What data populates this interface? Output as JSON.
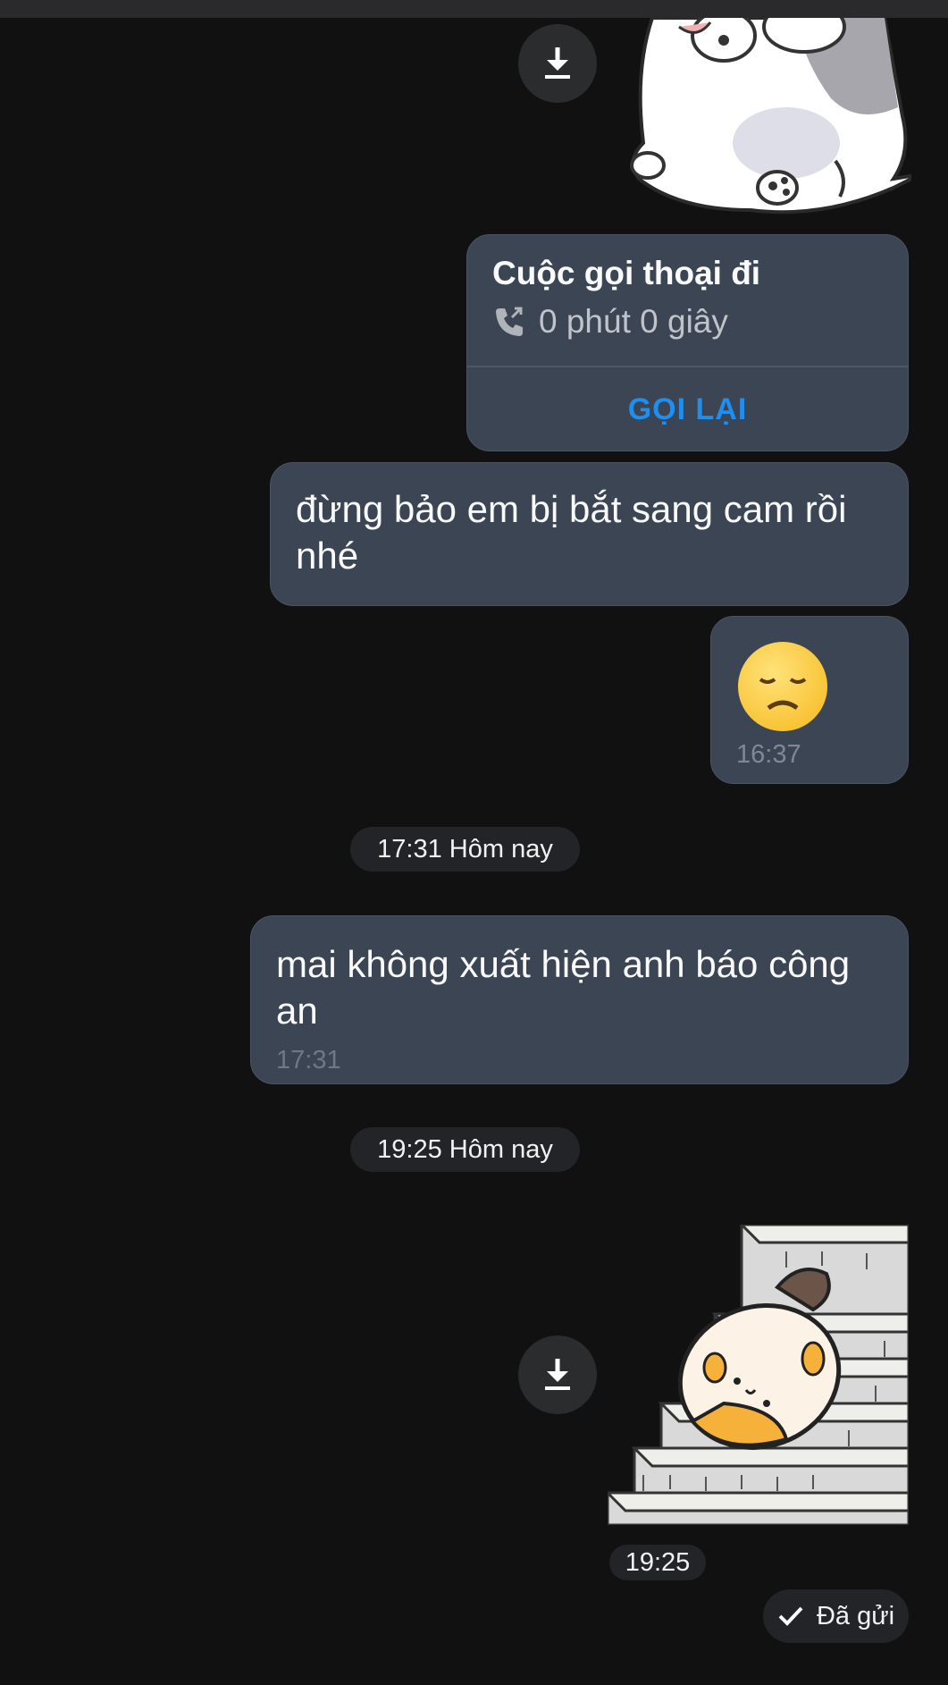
{
  "call": {
    "title": "Cuộc gọi thoại đi",
    "duration": "0 phút 0 giây",
    "callback_label": "GỌI LẠI"
  },
  "messages": [
    {
      "text": "đừng bảo em bị bắt sang cam rồi nhé"
    },
    {
      "emoji": "😞",
      "time": "16:37"
    },
    {
      "text": "mai không xuất hiện anh báo công an",
      "time": "17:31"
    }
  ],
  "separators": [
    "17:31 Hôm nay",
    "19:25 Hôm nay"
  ],
  "sticker_time": "19:25",
  "status": {
    "label": "Đã gửi"
  },
  "icons": {
    "download": "download-icon",
    "call": "outgoing-call-icon",
    "check": "check-icon"
  },
  "colors": {
    "background": "#111112",
    "bubble": "#3b4553",
    "accent": "#1f8ef1"
  }
}
